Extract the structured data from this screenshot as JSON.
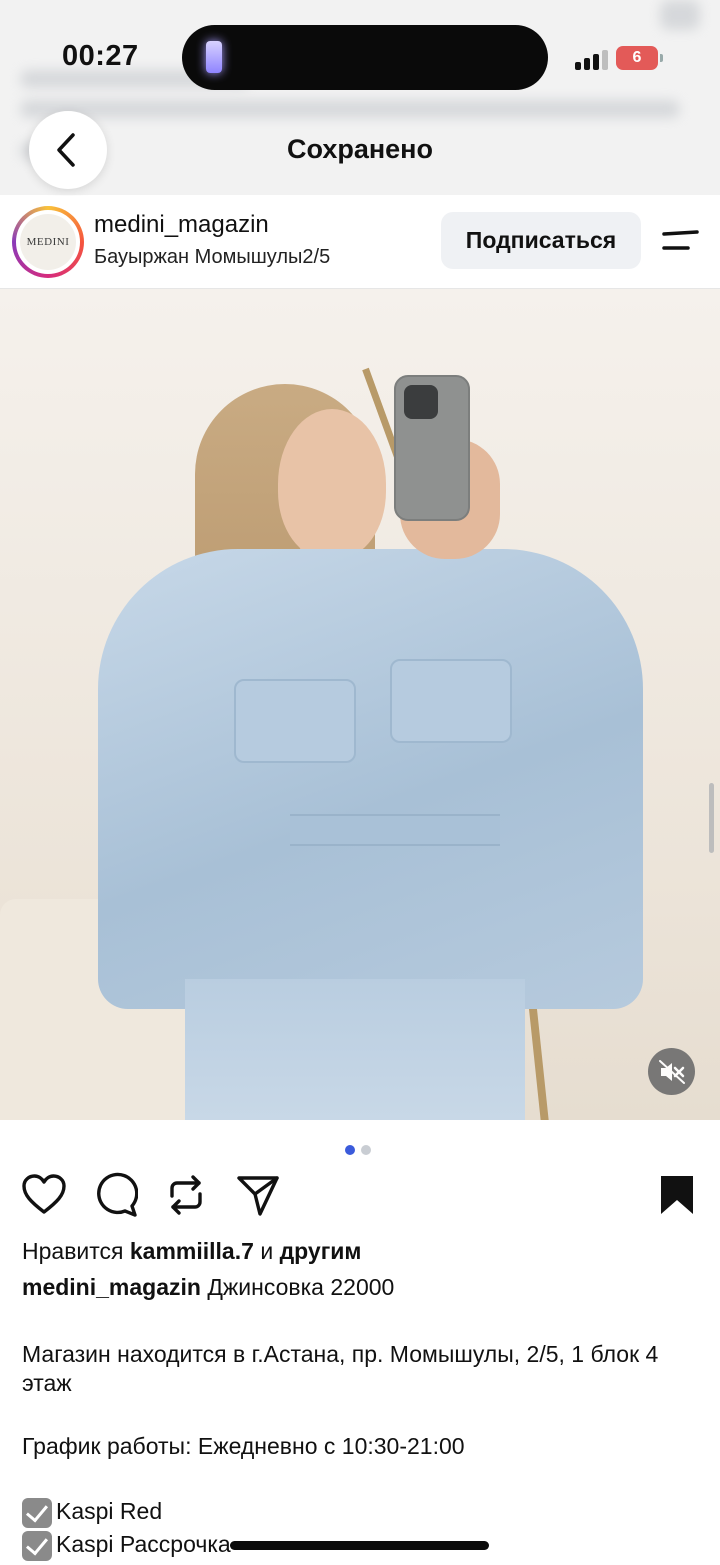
{
  "status_bar": {
    "time": "00:27",
    "battery_level": "6"
  },
  "nav": {
    "title": "Сохранено"
  },
  "post_header": {
    "avatar_text": "MEDINI",
    "username": "medini_magazin",
    "location": "Бауыржан Момышулы2/5",
    "follow_label": "Подписаться"
  },
  "carousel": {
    "total": 2,
    "current": 1,
    "active_color": "#3b5bdb",
    "inactive_color": "#c9cdd3"
  },
  "actions": {
    "icons": [
      "heart-icon",
      "comment-icon",
      "repost-icon",
      "share-icon",
      "bookmark-icon"
    ],
    "bookmark_saved": true
  },
  "likes": {
    "prefix": "Нравится",
    "user": "kammiilla.7",
    "joiner": "и",
    "others": "другим"
  },
  "caption": {
    "username": "medini_magazin",
    "text": "Джинсовка 22000"
  },
  "description": {
    "location_text": "Магазин находится в г.Астана, пр. Момышулы, 2/5, 1 блок 4 этаж",
    "hours_text": "График работы: Ежедневно с 10:30-21:00",
    "payment_options": [
      "Kaspi Red",
      "Kaspi Рассрочка"
    ]
  }
}
